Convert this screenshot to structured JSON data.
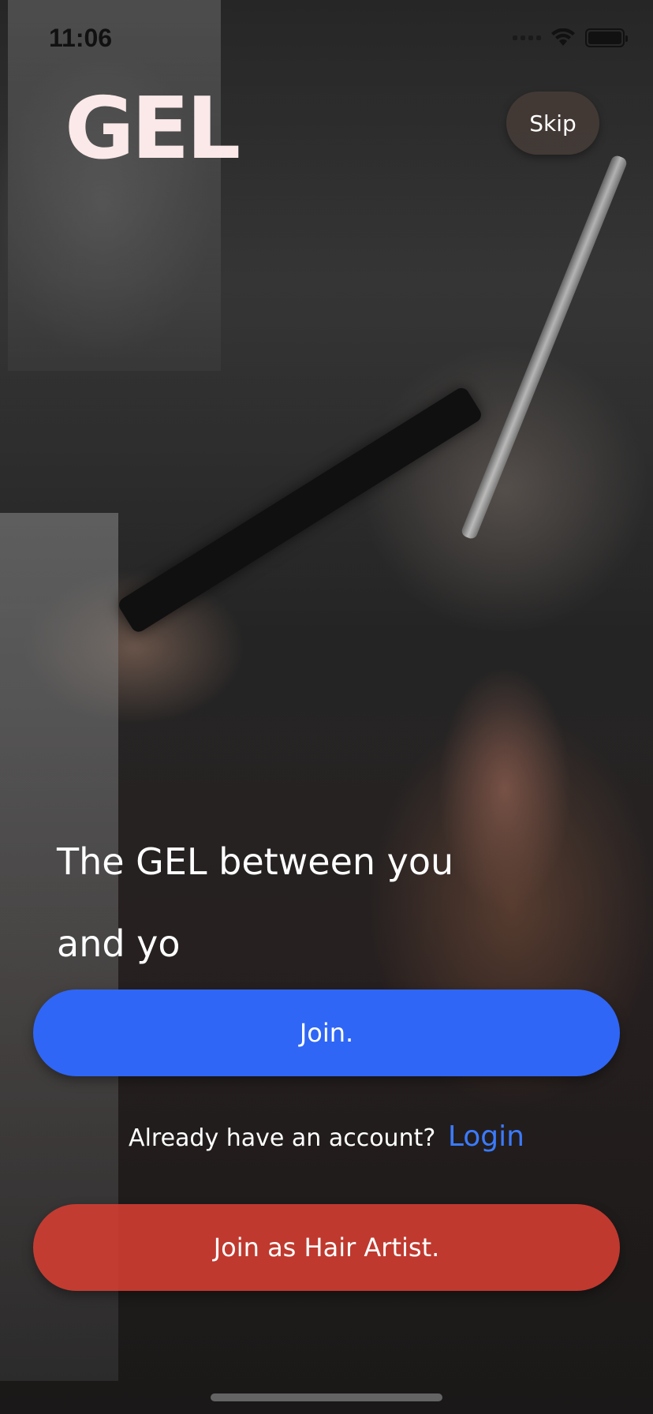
{
  "status_bar": {
    "time": "11:06"
  },
  "logo": {
    "text": "GEL"
  },
  "header": {
    "skip_label": "Skip"
  },
  "tagline": {
    "line1": "The GEL between you",
    "line2": "and yo"
  },
  "actions": {
    "join_label": "Join.",
    "login_prompt": "Already have an account?",
    "login_link": "Login",
    "artist_label": "Join as Hair Artist."
  },
  "colors": {
    "join_button": "#2f66f5",
    "artist_button": "#d63e32",
    "login_link": "#3b7bff",
    "logo": "#fbe9e9"
  },
  "icons": [
    "signal-icon",
    "wifi-icon",
    "battery-icon"
  ]
}
